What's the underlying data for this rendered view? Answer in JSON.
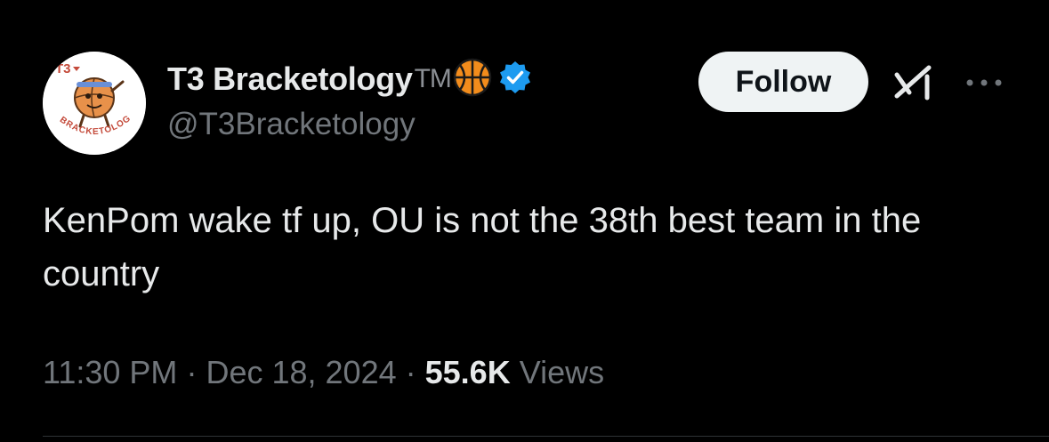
{
  "author": {
    "display_name": "T3 Bracketology",
    "name_suffix": "TM",
    "handle": "@T3Bracketology",
    "verified": true,
    "avatar_text_top": "T3",
    "avatar_text_bottom": "BRACKETOLOGY"
  },
  "actions": {
    "follow_label": "Follow",
    "grok_icon": "grok-icon",
    "more_icon": "more-horizontal-icon"
  },
  "tweet": {
    "text": "KenPom wake tf up, OU is not the 38th best team in the country",
    "time": "11:30 PM",
    "date": "Dec 18, 2024",
    "separator": "·",
    "views_count": "55.6K",
    "views_label": "Views"
  },
  "colors": {
    "background": "#000000",
    "primary_text": "#e7e9ea",
    "secondary_text": "#71767b",
    "verified_blue": "#1d9bf0",
    "basketball_orange": "#f28c1c",
    "follow_bg": "#eff3f4"
  }
}
